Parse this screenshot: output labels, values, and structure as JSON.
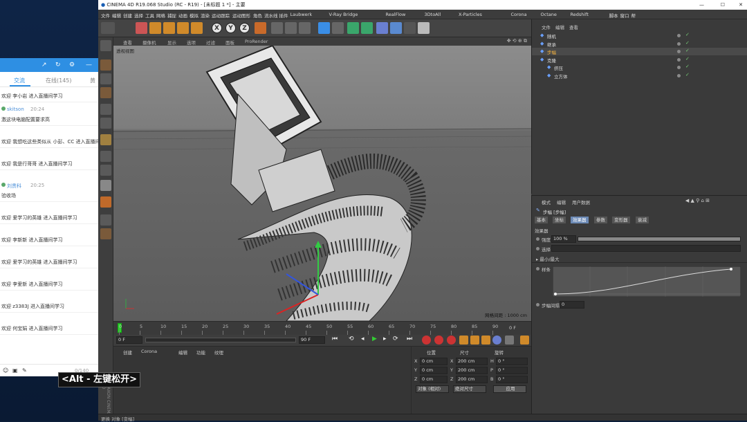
{
  "window": {
    "title": "CINEMA 4D R19.068 Studio (RC - R19) - [未标题 1 *] - 主要"
  },
  "menubar": [
    "文件",
    "编辑",
    "创建",
    "选择",
    "工具",
    "网格",
    "捕捉",
    "动画",
    "模拟",
    "渲染",
    "运动跟踪",
    "运动图形",
    "角色",
    "流水线",
    "插件",
    "Laubwerk",
    "V-Ray Bridge",
    "RealFlow",
    "3DtoAll",
    "X-Particles",
    "Corona",
    "Octane",
    "Redshift",
    "脚本",
    "窗口",
    "帮"
  ],
  "toolbar": {
    "axis_labels": [
      "X",
      "Y",
      "Z"
    ]
  },
  "viewport": {
    "menu": [
      "查看",
      "摄像机",
      "显示",
      "选项",
      "过滤",
      "面板",
      "ProRender"
    ],
    "label": "透视视图",
    "grid_info": "网格间距 : 1000 cm"
  },
  "timeline": {
    "ticks": [
      "0",
      "5",
      "10",
      "15",
      "20",
      "25",
      "30",
      "35",
      "40",
      "45",
      "50",
      "55",
      "60",
      "65",
      "70",
      "75",
      "80",
      "85",
      "90"
    ],
    "frame_field": "0 F",
    "start": "0 F",
    "end": "90 F"
  },
  "material_panel": {
    "menu": [
      "创建",
      "Corona",
      "编辑",
      "功能",
      "纹理"
    ]
  },
  "coords": {
    "headers": [
      "位置",
      "尺寸",
      "旋转"
    ],
    "rows": [
      {
        "axis": "X",
        "pos": "0 cm",
        "size_axis": "X",
        "size": "200 cm",
        "rot_axis": "H",
        "rot": "0 °"
      },
      {
        "axis": "Y",
        "pos": "0 cm",
        "size_axis": "Y",
        "size": "200 cm",
        "rot_axis": "P",
        "rot": "0 °"
      },
      {
        "axis": "Z",
        "pos": "0 cm",
        "size_axis": "Z",
        "size": "200 cm",
        "rot_axis": "B",
        "rot": "0 °"
      }
    ],
    "mode_select": "对象 (相对)",
    "size_select": "绝对尺寸",
    "apply": "应用"
  },
  "object_manager": {
    "menu": [
      "文件",
      "编辑",
      "查看"
    ],
    "items": [
      {
        "label": "随机",
        "indent": 0
      },
      {
        "label": "继承",
        "indent": 0
      },
      {
        "label": "步幅",
        "indent": 0
      },
      {
        "label": "克隆",
        "indent": 0
      },
      {
        "label": "挤压",
        "indent": 1
      },
      {
        "label": "立方体",
        "indent": 1
      }
    ]
  },
  "attributes": {
    "menu": [
      "模式",
      "编辑",
      "用户数据"
    ],
    "object_name": "步幅 [步幅]",
    "tabs": [
      "基本",
      "坐标",
      "效果器",
      "参数",
      "变形器",
      "衰减"
    ],
    "active_tab": "效果器",
    "section": "效果器",
    "strength_label": "强度",
    "strength_value": "100 %",
    "strength_fraction": 1.0,
    "selection_label": "选择",
    "max_label": "最小/最大",
    "spline_label": "样条",
    "step_gap_label": "步幅间隔",
    "step_gap_value": "0"
  },
  "chat": {
    "tabs": [
      "交流",
      "在线(145)",
      "黄"
    ],
    "messages": [
      {
        "text": "欢迎 李小岩 进入直播间学习",
        "style": "normal"
      },
      {
        "text": "skitson",
        "style": "blue",
        "time": "20:24"
      },
      {
        "text": "激这块电脑配置要求高",
        "style": "normal"
      },
      {
        "text": "欢迎 我想吃这些类似从 小彭、CC 进入直播间",
        "style": "normal"
      },
      {
        "text": "欢迎 我是行哥哥 进入直播间学习",
        "style": "normal"
      },
      {
        "text": "刘贵科",
        "style": "blue",
        "time": "20:25"
      },
      {
        "text": "验收场",
        "style": "normal"
      },
      {
        "text": "欢迎 爱学习的英雄 进入直播间学习",
        "style": "normal"
      },
      {
        "text": "欢迎 李新新 进入直播间学习",
        "style": "normal"
      },
      {
        "text": "欢迎 爱学习的英雄 进入直播间学习",
        "style": "normal"
      },
      {
        "text": "欢迎 李爱新 进入直播间学习",
        "style": "normal"
      },
      {
        "text": "欢迎 z3383J 进入直播间学习",
        "style": "normal"
      },
      {
        "text": "欢迎 何宝娟 进入直播间学习",
        "style": "normal"
      }
    ],
    "counter": "0/140"
  },
  "subtitle": "<Alt - 左键松开>",
  "statusbar": "更换 对象 [变幅]"
}
